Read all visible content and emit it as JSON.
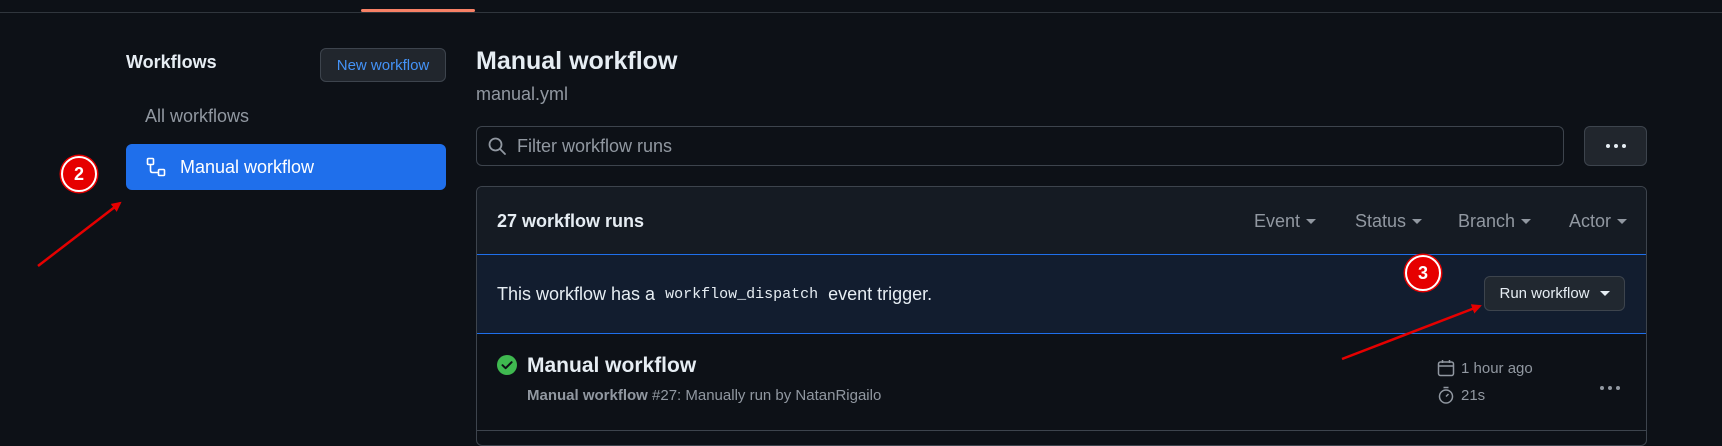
{
  "sidebar": {
    "title": "Workflows",
    "new_button": "New workflow",
    "items": [
      {
        "label": "All workflows",
        "active": false
      },
      {
        "label": "Manual workflow",
        "active": true
      }
    ]
  },
  "header": {
    "title": "Manual workflow",
    "filename": "manual.yml"
  },
  "search": {
    "placeholder": "Filter workflow runs",
    "value": ""
  },
  "runs": {
    "count_label": "27 workflow runs",
    "filters": [
      "Event",
      "Status",
      "Branch",
      "Actor"
    ]
  },
  "dispatch": {
    "prefix": "This workflow has a",
    "code": "workflow_dispatch",
    "suffix": "event trigger.",
    "run_button": "Run workflow"
  },
  "run_list": [
    {
      "title": "Manual workflow",
      "workflow_name": "Manual workflow",
      "detail": "#27: Manually run by NatanRigailo",
      "time": "1 hour ago",
      "duration": "21s",
      "status": "success"
    }
  ],
  "annotations": [
    "2",
    "3"
  ],
  "colors": {
    "background": "#0d1117",
    "accent": "#1f6feb",
    "link": "#4493f8",
    "success": "#3fb950",
    "annotation": "#e60000",
    "tab_underline": "#f78166"
  }
}
